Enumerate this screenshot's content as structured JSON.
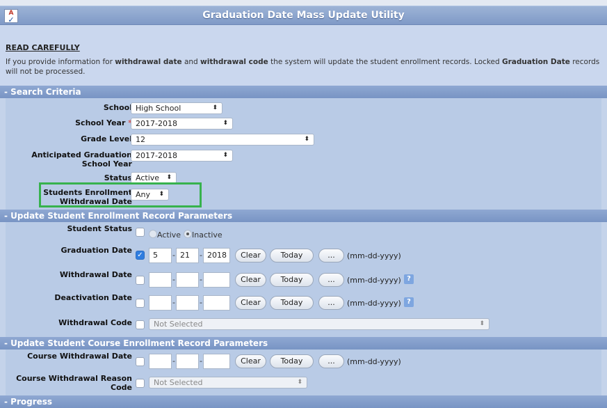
{
  "app": {
    "title": "Graduation Date Mass Update Utility"
  },
  "intro": {
    "heading": "READ CAREFULLY",
    "text_parts": [
      "If you provide information for ",
      "withdrawal date",
      " and ",
      "withdrawal code",
      " the system will update the student enrollment records. Locked ",
      "Graduation Date",
      " records will not be processed."
    ]
  },
  "sections": {
    "search": "- Search Criteria",
    "update_enrollment": "- Update Student Enrollment Record Parameters",
    "update_course": "- Update Student Course Enrollment Record Parameters",
    "progress": "- Progress"
  },
  "search": {
    "school": {
      "label": "School",
      "value": "High School"
    },
    "school_year": {
      "label": "School Year",
      "required": "*",
      "value": "2017-2018"
    },
    "grade_level": {
      "label": "Grade Level",
      "value": "12"
    },
    "anticipated": {
      "label": [
        "Anticipated Graduation",
        "School Year"
      ],
      "value": "2017-2018"
    },
    "status": {
      "label": "Status",
      "value": "Active"
    },
    "withdrawal_filter": {
      "label": [
        "Students Enrollment",
        "Withdrawal Date"
      ],
      "value": "Any"
    }
  },
  "enrollment": {
    "student_status": {
      "label": "Student Status",
      "options": [
        "Active",
        "Inactive"
      ],
      "selected": "Inactive"
    },
    "graduation_date": {
      "label": "Graduation Date",
      "checked": true,
      "month": "5",
      "day": "21",
      "year": "2018"
    },
    "withdrawal_date": {
      "label": "Withdrawal Date",
      "checked": false
    },
    "deactivation_date": {
      "label": "Deactivation Date",
      "checked": false
    },
    "withdrawal_code": {
      "label": "Withdrawal Code",
      "value": "Not Selected"
    }
  },
  "course": {
    "withdrawal_date": {
      "label": "Course Withdrawal Date"
    },
    "reason": {
      "label": [
        "Course Withdrawal Reason",
        "Code"
      ],
      "value": "Not Selected"
    }
  },
  "buttons": {
    "clear": "Clear",
    "today": "Today",
    "picker": "..."
  },
  "date_format": "(mm-dd-yyyy)",
  "help_glyph": "?",
  "arrow_glyph": "⬍",
  "colors": {
    "header_blue": "#7f9ac7",
    "section_blue": "#7894c4",
    "highlight_green": "#37b24d",
    "required_red": "#d9534f"
  }
}
